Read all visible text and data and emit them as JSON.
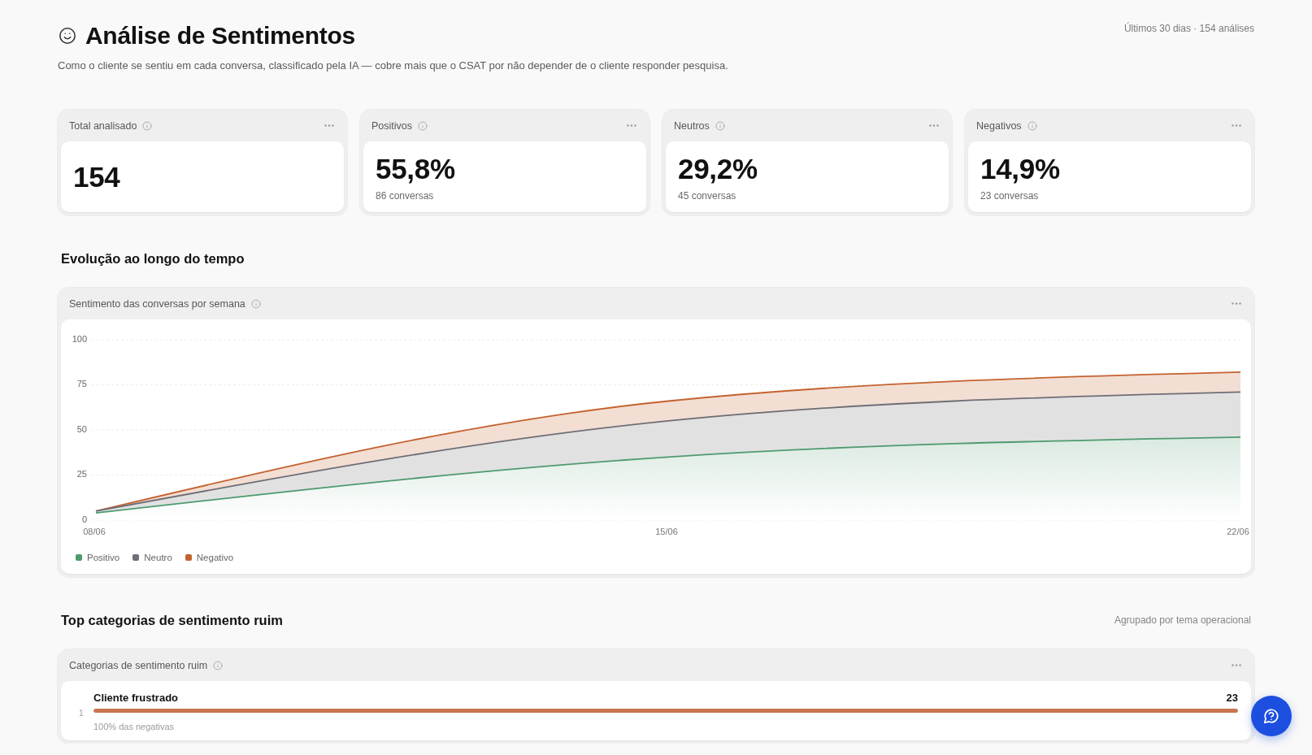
{
  "header": {
    "title": "Análise de Sentimentos",
    "subtitle": "Como o cliente se sentiu em cada conversa, classificado pela IA — cobre mais que o CSAT por não depender de o cliente responder pesquisa.",
    "period": "Últimos 30 dias · 154 análises"
  },
  "kpis": [
    {
      "label": "Total analisado",
      "value": "154"
    },
    {
      "label": "Positivos",
      "value": "55,8%",
      "detail": "86 conversas"
    },
    {
      "label": "Neutros",
      "value": "29,2%",
      "detail": "45 conversas"
    },
    {
      "label": "Negativos",
      "value": "14,9%",
      "detail": "23 conversas"
    }
  ],
  "evolution": {
    "heading": "Evolução ao longo do tempo",
    "chart_data": {
      "type": "area",
      "title": "Sentimento das conversas por semana",
      "x": [
        "08/06",
        "15/06",
        "22/06"
      ],
      "series": [
        {
          "name": "Positivo",
          "color": "#4e9a6e",
          "values": [
            4,
            35,
            46
          ]
        },
        {
          "name": "Neutro",
          "color": "#6e6e76",
          "values": [
            5,
            55,
            71
          ]
        },
        {
          "name": "Negativo",
          "color": "#c4622f",
          "values": [
            5,
            66,
            82
          ]
        }
      ],
      "ylim": [
        0,
        100
      ],
      "yticks": [
        0,
        25,
        50,
        75,
        100
      ],
      "grid": true,
      "legend": "bottom"
    }
  },
  "categories": {
    "heading": "Top categorias de sentimento ruim",
    "note": "Agrupado por tema operacional",
    "card_title": "Categorias de sentimento ruim",
    "items": [
      {
        "rank": "1",
        "name": "Cliente frustrado",
        "count": "23",
        "level": 1,
        "share": "100% das negativas"
      }
    ]
  }
}
